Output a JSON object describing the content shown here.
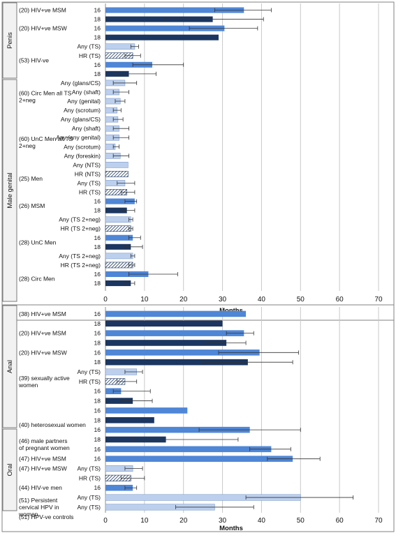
{
  "chart_data": [
    {
      "type": "bar",
      "orientation": "horizontal",
      "panel": "top",
      "xlabel": "Months",
      "xlim": [
        0,
        70
      ],
      "xticks": [
        0,
        10,
        20,
        30,
        40,
        50,
        60,
        70
      ],
      "grid": true,
      "sections": [
        {
          "label": "Penis",
          "from": 0,
          "to": 7
        },
        {
          "label": "Male genital",
          "from": 8,
          "to": 29
        }
      ],
      "groups": [
        {
          "label": "(20) HIV+ve MSM",
          "row": 0
        },
        {
          "label": "(20) HIV+ve MSW",
          "row": 2
        },
        {
          "label": "(53) HIV-ve",
          "row": 5.5
        },
        {
          "label": "(60) Circ Men all TS 2+neg",
          "row": 9.5
        },
        {
          "label": "(60) UnC Men all TS 2+neg",
          "row": 14.5
        },
        {
          "label": "(25) Men",
          "row": 18.5
        },
        {
          "label": "(26) MSM",
          "row": 21.5
        },
        {
          "label": "(28) UnC Men",
          "row": 25.5
        },
        {
          "label": "(28) Circ Men",
          "row": 29.5
        }
      ],
      "rows": [
        {
          "category": "16",
          "value": 35.5,
          "err": [
            28,
            42.5
          ],
          "style": "mid"
        },
        {
          "category": "18",
          "value": 27.5,
          "err": [
            15,
            40.5
          ],
          "style": "dark"
        },
        {
          "category": "16",
          "value": 30.5,
          "err": [
            21.5,
            39
          ],
          "style": "mid"
        },
        {
          "category": "18",
          "value": 29,
          "err": null,
          "style": "dark"
        },
        {
          "category": "Any (TS)",
          "value": 7.5,
          "err": [
            6.5,
            8.5
          ],
          "style": "light"
        },
        {
          "category": "HR (TS)",
          "value": 7,
          "err": [
            5,
            9
          ],
          "style": "hatch"
        },
        {
          "category": "16",
          "value": 12,
          "err": [
            7,
            20
          ],
          "style": "mid"
        },
        {
          "category": "18",
          "value": 6,
          "err": [
            3,
            13
          ],
          "style": "dark"
        },
        {
          "category": "Any (glans/CS)",
          "value": 5,
          "err": [
            2,
            8
          ],
          "style": "light"
        },
        {
          "category": "Any (shaft)",
          "value": 3.5,
          "err": [
            2,
            6
          ],
          "style": "light"
        },
        {
          "category": "Any (genital)",
          "value": 3.8,
          "err": [
            2.5,
            5
          ],
          "style": "light"
        },
        {
          "category": "Any (scrotum)",
          "value": 3,
          "err": [
            2,
            4
          ],
          "style": "light"
        },
        {
          "category": "Any (glans/CS)",
          "value": 3.2,
          "err": [
            2,
            4.5
          ],
          "style": "light"
        },
        {
          "category": "Any (shaft)",
          "value": 3.5,
          "err": [
            2,
            6
          ],
          "style": "light"
        },
        {
          "category": "Any (any genital)",
          "value": 3.5,
          "err": [
            2,
            6
          ],
          "style": "light"
        },
        {
          "category": "Any (scrotum)",
          "value": 2.5,
          "err": [
            2,
            3.5
          ],
          "style": "light"
        },
        {
          "category": "Any (foreskin)",
          "value": 3.8,
          "err": [
            2,
            6
          ],
          "style": "light"
        },
        {
          "category": "Any (NTS)",
          "value": 5.8,
          "err": null,
          "style": "light"
        },
        {
          "category": "HR (NTS)",
          "value": 5.8,
          "err": null,
          "style": "hatch"
        },
        {
          "category": "Any (TS)",
          "value": 5,
          "err": [
            3,
            7.5
          ],
          "style": "light"
        },
        {
          "category": "HR (TS)",
          "value": 5.5,
          "err": [
            4,
            7.5
          ],
          "style": "hatch"
        },
        {
          "category": "16",
          "value": 7.5,
          "err": [
            5,
            8
          ],
          "style": "mid"
        },
        {
          "category": "18",
          "value": 5.5,
          "err": [
            4,
            7.5
          ],
          "style": "dark"
        },
        {
          "category": "Any (TS 2+neg)",
          "value": 6.5,
          "err": [
            6,
            7
          ],
          "style": "light"
        },
        {
          "category": "HR (TS 2+neg)",
          "value": 6.5,
          "err": [
            6,
            7
          ],
          "style": "hatch"
        },
        {
          "category": "16",
          "value": 7,
          "err": [
            6,
            9
          ],
          "style": "mid"
        },
        {
          "category": "18",
          "value": 6.5,
          "err": [
            5,
            9.5
          ],
          "style": "dark"
        },
        {
          "category": "Any (TS 2+neg)",
          "value": 7,
          "err": [
            6.5,
            7.5
          ],
          "style": "light"
        },
        {
          "category": "HR (TS 2+neg)",
          "value": 7,
          "err": [
            6,
            7.5
          ],
          "style": "hatch"
        },
        {
          "category": "16",
          "value": 11,
          "err": [
            6,
            18.5
          ],
          "style": "mid"
        },
        {
          "category": "18",
          "value": 6.5,
          "err": [
            5,
            7.5
          ],
          "style": "dark"
        }
      ]
    },
    {
      "type": "bar",
      "orientation": "horizontal",
      "panel": "bottom",
      "xlabel": "Months",
      "xlim": [
        0,
        70
      ],
      "xticks": [
        0,
        10,
        20,
        30,
        40,
        50,
        60,
        70
      ],
      "grid": true,
      "sections": [
        {
          "label": "Anal",
          "from": 0,
          "to": 12
        },
        {
          "label": "Oral",
          "from": 13,
          "to": 21
        }
      ],
      "groups": [
        {
          "label": "(38) HIV+ve MSM",
          "row": 0
        },
        {
          "label": "(20) HIV+ve MSM",
          "row": 2
        },
        {
          "label": "(20) HIV+ve MSW",
          "row": 4
        },
        {
          "label": "(39) sexually active women",
          "row": 7
        },
        {
          "label": "(40) heterosexual women",
          "row": 11.5
        },
        {
          "label": "(46) male partners of pregnant women",
          "row": 13.5
        },
        {
          "label": "(47) HIV+ve MSM",
          "row": 15
        },
        {
          "label": "(47) HIV+ve MSW",
          "row": 16
        },
        {
          "label": "(44) HIV-ve men",
          "row": 18
        },
        {
          "label": "(51) Persistent cervical HPV in women",
          "row": 20
        },
        {
          "label": "(51) HPV-ve controls",
          "row": 21
        }
      ],
      "rows": [
        {
          "category": "16",
          "value": 36,
          "err": null,
          "style": "mid"
        },
        {
          "category": "18",
          "value": 30,
          "err": null,
          "style": "dark"
        },
        {
          "category": "16",
          "value": 35.5,
          "err": [
            31,
            38
          ],
          "style": "mid"
        },
        {
          "category": "18",
          "value": 31,
          "err": [
            26,
            36
          ],
          "style": "dark"
        },
        {
          "category": "16",
          "value": 39.5,
          "err": [
            29,
            49.5
          ],
          "style": "mid"
        },
        {
          "category": "18",
          "value": 36.5,
          "err": [
            25,
            48
          ],
          "style": "dark"
        },
        {
          "category": "Any (TS)",
          "value": 8,
          "err": [
            5,
            9.5
          ],
          "style": "light"
        },
        {
          "category": "HR (TS)",
          "value": 5,
          "err": [
            3,
            8
          ],
          "style": "hatch"
        },
        {
          "category": "16",
          "value": 4,
          "err": [
            2,
            11.5
          ],
          "style": "mid"
        },
        {
          "category": "18",
          "value": 7,
          "err": [
            4,
            12
          ],
          "style": "dark"
        },
        {
          "category": "16",
          "value": 21,
          "err": null,
          "style": "mid"
        },
        {
          "category": "18",
          "value": 12.5,
          "err": null,
          "style": "dark"
        },
        {
          "category": "16",
          "value": 37,
          "err": [
            24,
            50
          ],
          "style": "mid"
        },
        {
          "category": "18",
          "value": 15.5,
          "err": [
            7,
            34
          ],
          "style": "dark"
        },
        {
          "category": "16",
          "value": 42.5,
          "err": [
            37,
            47.5
          ],
          "style": "mid"
        },
        {
          "category": "16",
          "value": 48,
          "err": [
            41.5,
            55
          ],
          "style": "mid"
        },
        {
          "category": "Any (TS)",
          "value": 7,
          "err": [
            5,
            9.5
          ],
          "style": "light"
        },
        {
          "category": "HR (TS)",
          "value": 6.5,
          "err": [
            4,
            10
          ],
          "style": "hatch"
        },
        {
          "category": "16",
          "value": 7,
          "err": [
            5,
            8
          ],
          "style": "mid"
        },
        {
          "category": "Any (TS)",
          "value": 50,
          "err": [
            36,
            63.5
          ],
          "style": "light"
        },
        {
          "category": "Any (TS)",
          "value": 28,
          "err": [
            18,
            38
          ],
          "style": "light"
        }
      ]
    }
  ],
  "colors": {
    "mid": "#4f86d6",
    "dark": "#1b3660",
    "light": "#bcd0ee",
    "hatch_line": "#1b3660",
    "grid": "#c8c8c8",
    "panel_border": "#808080"
  }
}
